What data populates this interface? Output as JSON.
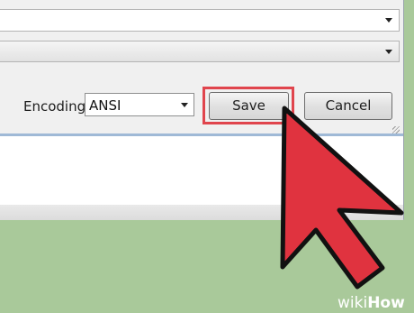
{
  "dialog": {
    "encoding_label": "Encoding:",
    "encoding_value": "ANSI",
    "save_label": "Save",
    "cancel_label": "Cancel"
  },
  "watermark": {
    "prefix": "wiki",
    "suffix": "How"
  },
  "colors": {
    "highlight": "#e0454d",
    "pointer": "#e0333f",
    "background": "#a9c99a"
  }
}
